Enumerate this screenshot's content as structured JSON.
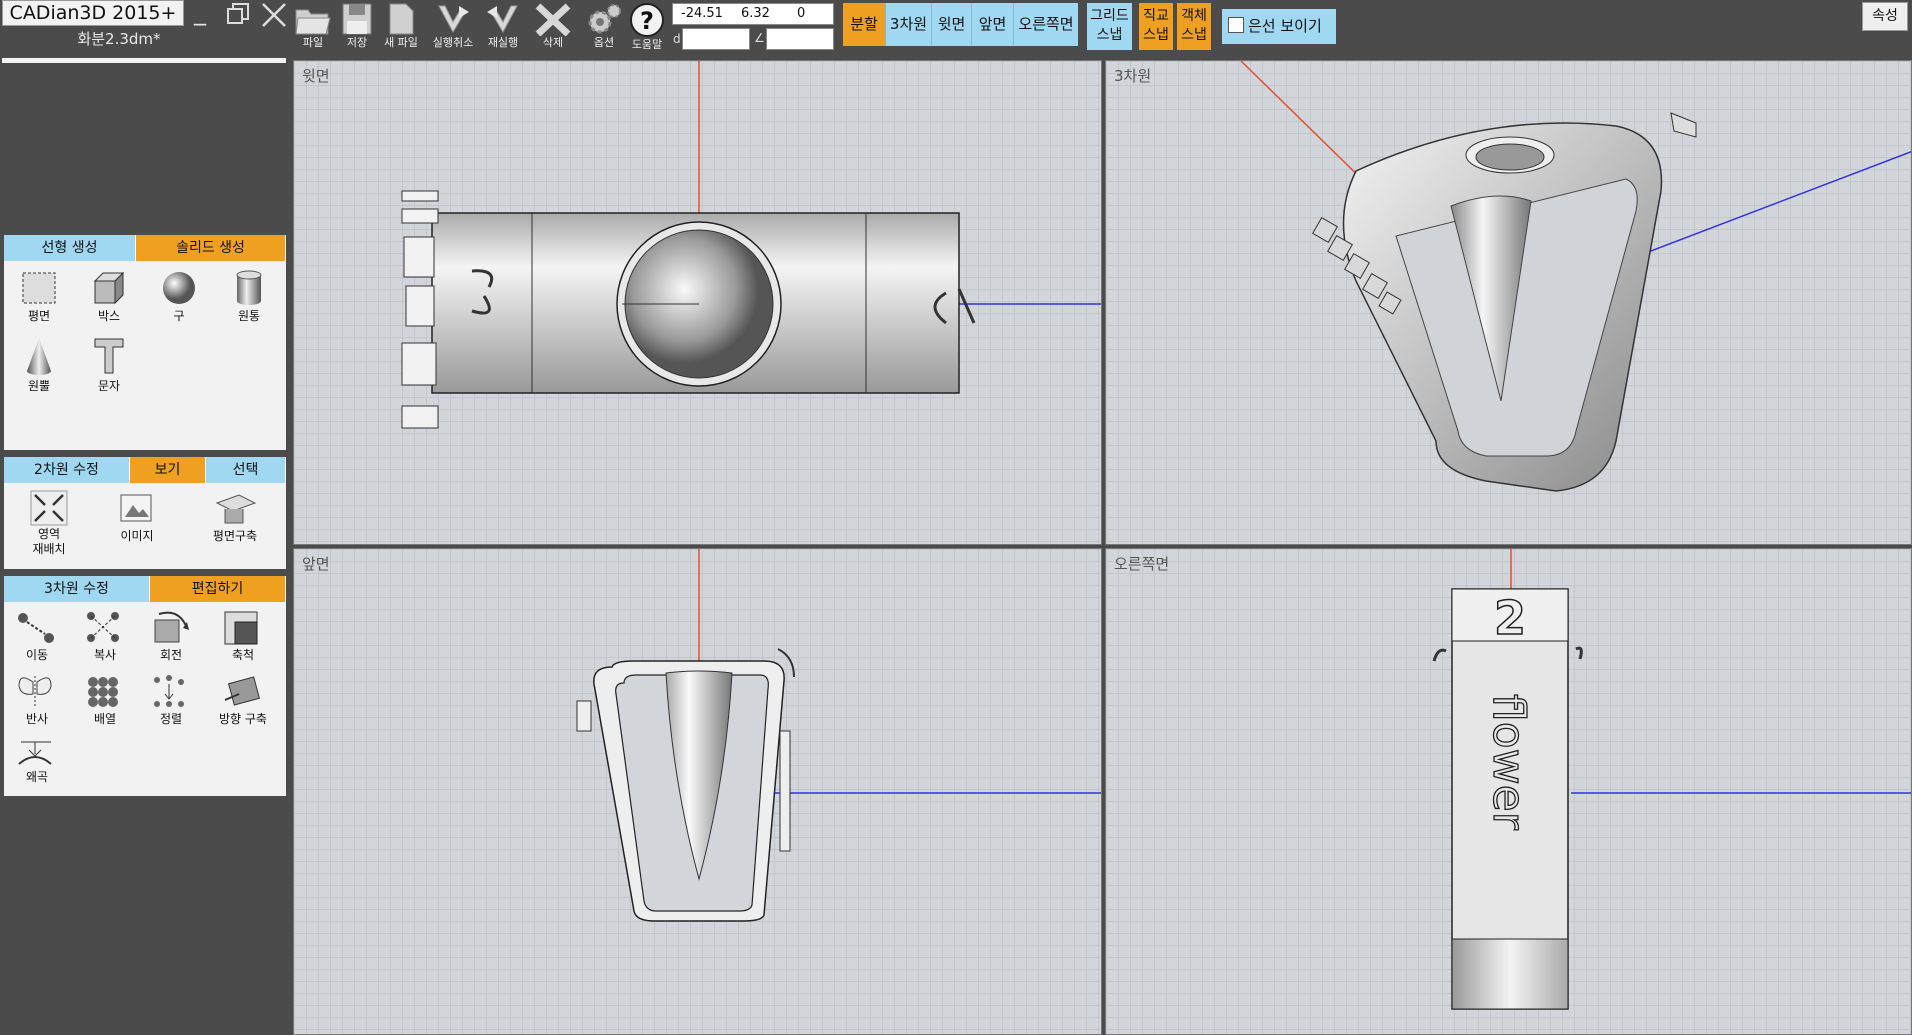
{
  "app": {
    "title": "CADian3D 2015+",
    "document": "화분2.3dm*"
  },
  "toolbar": {
    "buttons": [
      {
        "id": "file",
        "label": "파일"
      },
      {
        "id": "save",
        "label": "저장"
      },
      {
        "id": "new",
        "label": "새 파일"
      },
      {
        "id": "undo",
        "label": "실행취소"
      },
      {
        "id": "redo",
        "label": "재실행"
      },
      {
        "id": "delete",
        "label": "삭제"
      },
      {
        "id": "options",
        "label": "옵션"
      },
      {
        "id": "help",
        "label": "도움말"
      }
    ],
    "coords": {
      "x": "-24.51",
      "y": "6.32",
      "z": "0",
      "d_label": "d",
      "angle_label": "∠",
      "d_value": "",
      "angle_value": ""
    },
    "view_tabs": [
      "분할",
      "3차원",
      "윗면",
      "앞면",
      "오른쪽면"
    ],
    "active_view_tab": "분할",
    "snaps": [
      {
        "line1": "그리드",
        "line2": "스냅",
        "on": false
      },
      {
        "line1": "직교",
        "line2": "스냅",
        "on": true
      },
      {
        "line1": "객체",
        "line2": "스냅",
        "on": true
      }
    ],
    "hidden_lines_label": "은선 보이기",
    "hidden_lines_checked": false,
    "properties_label": "속성"
  },
  "panels": {
    "creation": {
      "tabs": [
        "선형 생성",
        "솔리드 생성"
      ],
      "active": 1,
      "tools": [
        "평면",
        "박스",
        "구",
        "원통",
        "원뿔",
        "문자"
      ]
    },
    "modify2d": {
      "tabs": [
        "2차원 수정",
        "보기",
        "선택"
      ],
      "active": 1,
      "tools": [
        "영역\n재배치",
        "이미지",
        "평면구축"
      ]
    },
    "modify3d": {
      "tabs": [
        "3차원 수정",
        "편집하기"
      ],
      "active": 1,
      "tools": [
        "이동",
        "복사",
        "회전",
        "축척",
        "반사",
        "배열",
        "정렬",
        "방향 구축",
        "왜곡"
      ]
    }
  },
  "viewports": {
    "top": "윗면",
    "perspective": "3차원",
    "front": "앞면",
    "right": "오른쪽면"
  },
  "model_text": {
    "number": "2",
    "word": "flower"
  },
  "colors": {
    "accent_orange": "#f0a020",
    "tab_blue": "#9fd8f0",
    "axis_red": "#e05030",
    "axis_blue": "#3030e0"
  }
}
